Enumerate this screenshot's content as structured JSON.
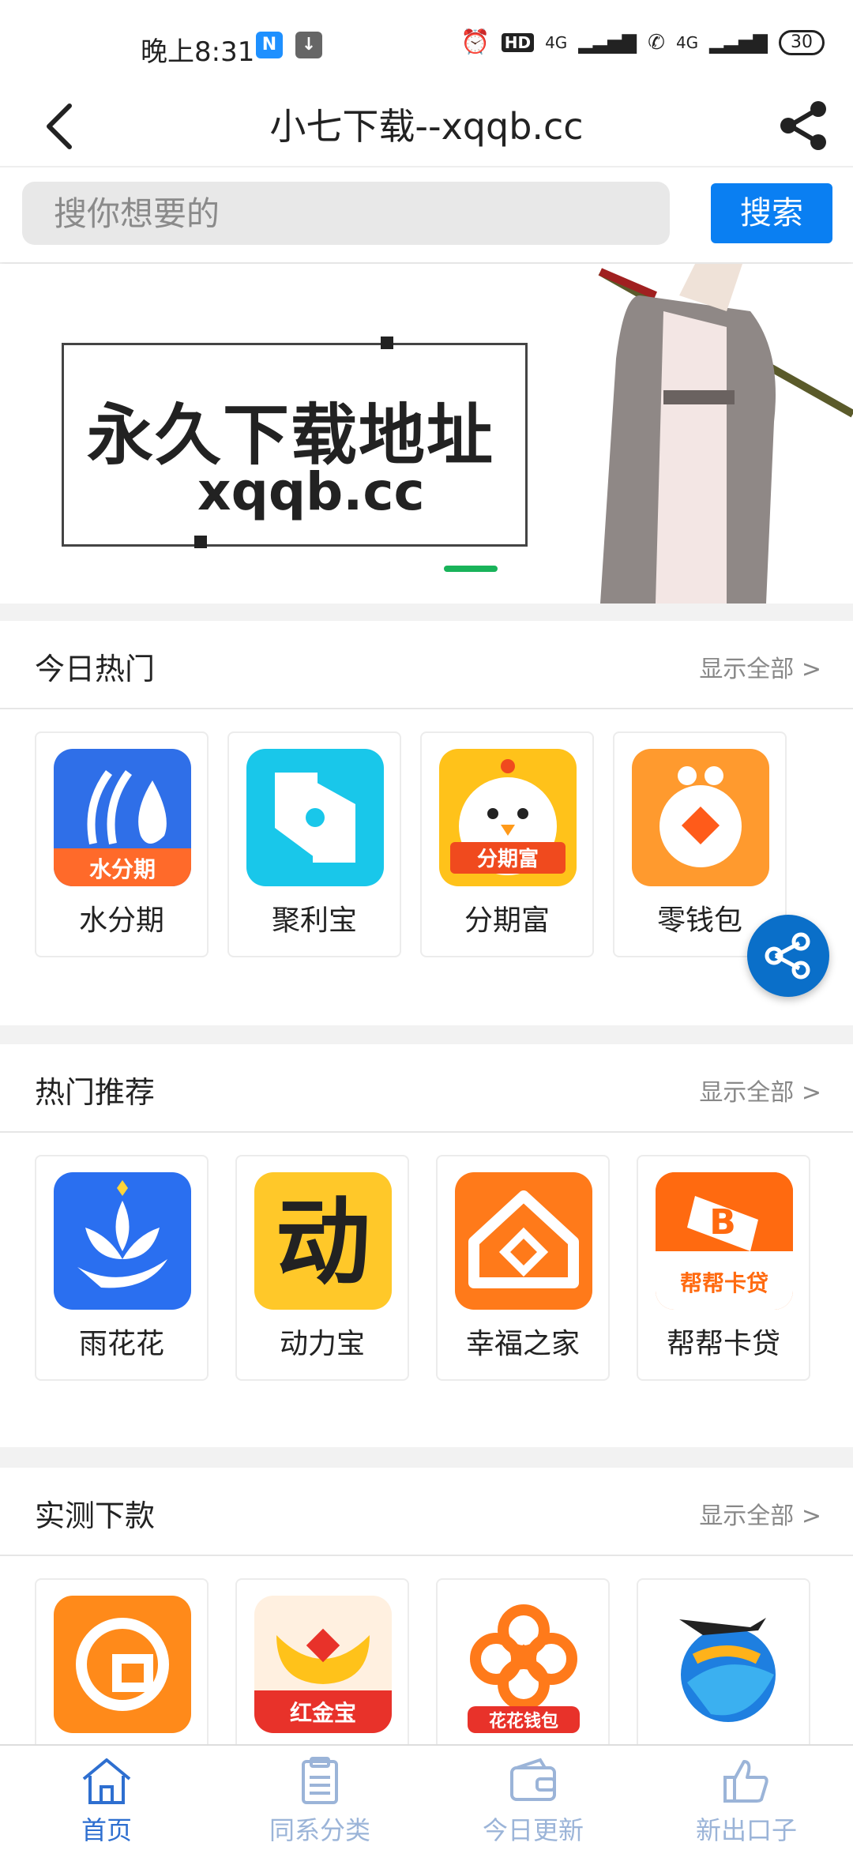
{
  "status": {
    "time": "晚上8:31",
    "battery": "30",
    "signal_1": "4G",
    "signal_2": "4G",
    "hd": "HD"
  },
  "header": {
    "title": "小七下载--xqqb.cc"
  },
  "search": {
    "placeholder": "搜你想要的",
    "button_label": "搜索"
  },
  "banner": {
    "headline": "永久下载地址",
    "subline": "xqqb.cc"
  },
  "sections": [
    {
      "title": "今日热门",
      "more": "显示全部 >",
      "apps": [
        {
          "name": "水分期",
          "icon_text": "水分期",
          "icon": "water-drop-icon",
          "color": "#2f6fe8",
          "accent": "#ff6a2a"
        },
        {
          "name": "聚利宝",
          "icon_text": "",
          "icon": "jlb-logo-icon",
          "color": "#19c7ea",
          "accent": "#ffffff"
        },
        {
          "name": "分期富",
          "icon_text": "分期富",
          "icon": "chick-icon",
          "color": "#ffc21a",
          "accent": "#f04a1e"
        },
        {
          "name": "零钱包",
          "icon_text": "",
          "icon": "coin-purse-icon",
          "color": "#ff9a2e",
          "accent": "#ff5b1a"
        }
      ]
    },
    {
      "title": "热门推荐",
      "more": "显示全部 >",
      "apps": [
        {
          "name": "雨花花",
          "icon_text": "",
          "icon": "lotus-icon",
          "color": "#2a6ff0",
          "accent": "#ffffff"
        },
        {
          "name": "动力宝",
          "icon_text": "动",
          "icon": "dong-char-icon",
          "color": "#ffc829",
          "accent": "#222222"
        },
        {
          "name": "幸福之家",
          "icon_text": "",
          "icon": "house-icon",
          "color": "#ff7a1a",
          "accent": "#ffffff"
        },
        {
          "name": "帮帮卡贷",
          "icon_text": "帮帮卡贷",
          "icon": "card-b-icon",
          "color": "#ff6a10",
          "accent": "#ffffff"
        }
      ]
    },
    {
      "title": "实测下款",
      "more": "显示全部 >",
      "apps": [
        {
          "name": "",
          "icon_text": "",
          "icon": "orange-g-icon",
          "color": "#ff8a1a",
          "accent": "#ffffff"
        },
        {
          "name": "",
          "icon_text": "红金宝",
          "icon": "gold-ingot-icon",
          "color": "#fff0e0",
          "accent": "#e8322a"
        },
        {
          "name": "",
          "icon_text": "花花钱包",
          "icon": "flower-wallet-icon",
          "color": "#ffffff",
          "accent": "#ff7a1a"
        },
        {
          "name": "",
          "icon_text": "",
          "icon": "plane-globe-icon",
          "color": "#ffffff",
          "accent": "#1e7fe0"
        }
      ]
    }
  ],
  "tabbar": {
    "items": [
      {
        "label": "首页",
        "icon": "home-icon",
        "active": true
      },
      {
        "label": "同系分类",
        "icon": "clipboard-icon",
        "active": false
      },
      {
        "label": "今日更新",
        "icon": "wallet-icon",
        "active": false
      },
      {
        "label": "新出口子",
        "icon": "thumbs-up-icon",
        "active": false
      }
    ]
  },
  "colors": {
    "primary": "#0a7ff2",
    "tab_active": "#2e6fd0",
    "tab_inactive": "#9bb4d8",
    "banner_indicator": "#19b35a"
  }
}
